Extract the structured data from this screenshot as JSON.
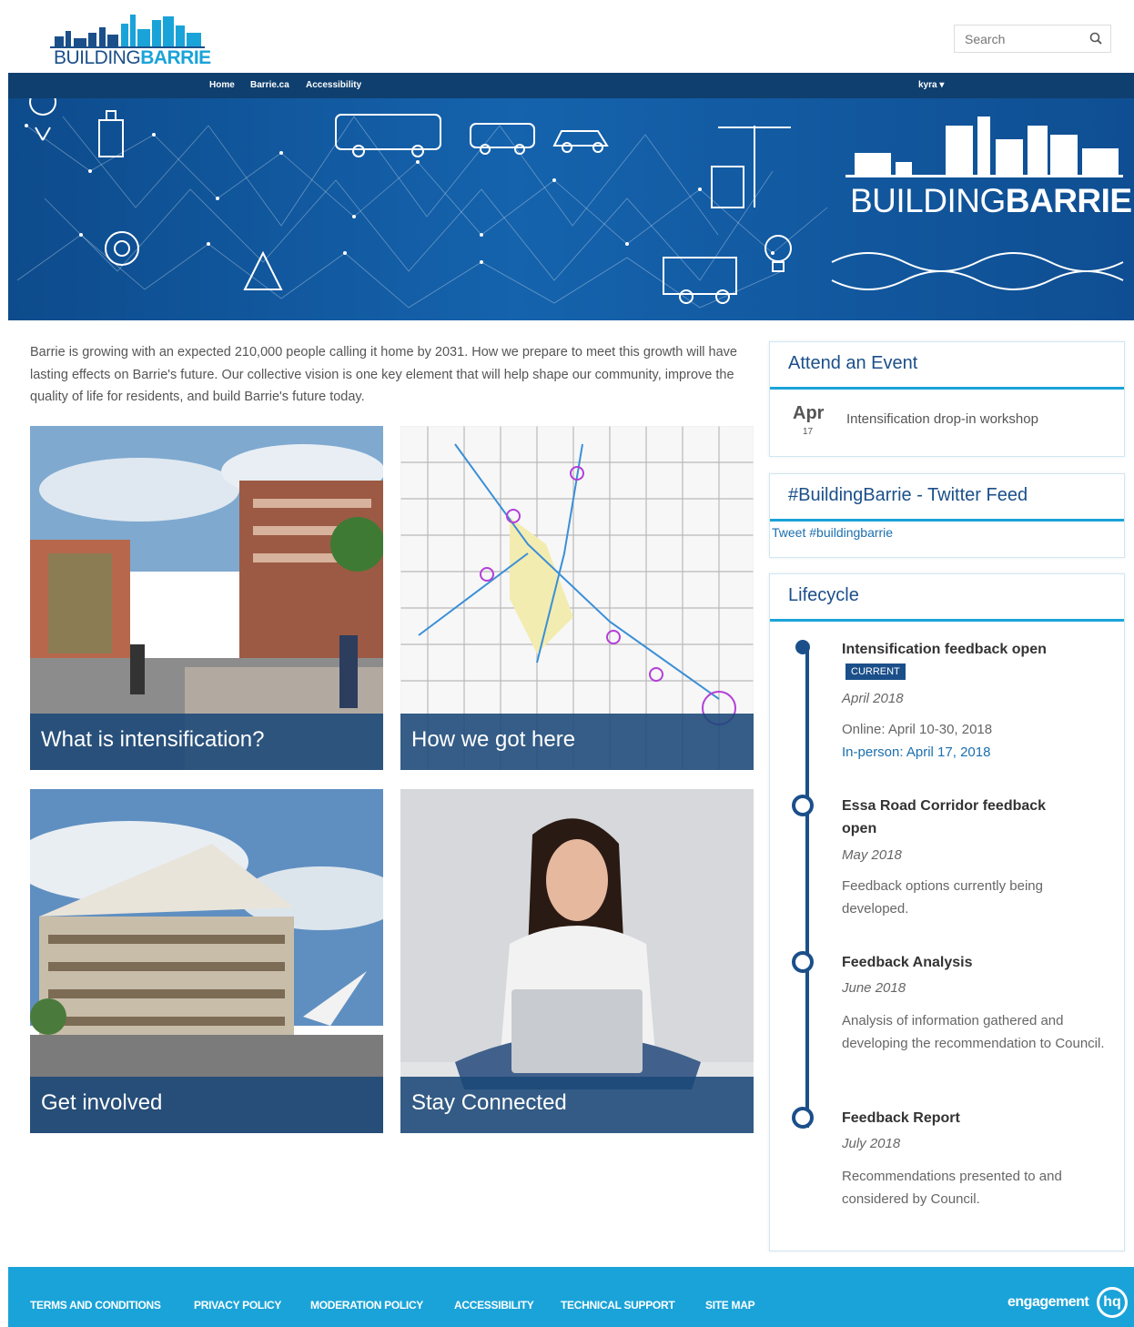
{
  "header": {
    "logo_text_a": "BUILDING",
    "logo_text_b": "BARRIE",
    "search_placeholder": "Search"
  },
  "topnav": {
    "links": [
      "Home",
      "Barrie.ca",
      "Accessibility"
    ],
    "user": "kyra ▾"
  },
  "banner": {
    "logo_text_a": "BUILDING",
    "logo_text_b": "BARRIE"
  },
  "intro": "Barrie is growing with an expected 210,000 people calling it home by 2031. How we prepare to meet this growth will have lasting effects on Barrie's future. Our collective vision is one key element that will help shape our community, improve the quality of life for residents, and build Barrie's future today.",
  "tiles": [
    {
      "label": "What is intensification?"
    },
    {
      "label": "How we got here"
    },
    {
      "label": "Get involved"
    },
    {
      "label": "Stay Connected"
    }
  ],
  "event_box": {
    "title": "Attend an Event",
    "month": "Apr",
    "day": "17",
    "event_title": "Intensification drop-in workshop"
  },
  "twitter_box": {
    "title": "#BuildingBarrie - Twitter Feed",
    "link": "Tweet #buildingbarrie"
  },
  "lifecycle": {
    "title": "Lifecycle",
    "stages": [
      {
        "title": "Intensification feedback open",
        "badge": "CURRENT",
        "date": "April 2018",
        "desc_1": "Online: April 10-30, 2018",
        "desc_2": "In-person: April 17, 2018"
      },
      {
        "title": "Essa Road Corridor feedback open",
        "date": "May 2018",
        "desc": "Feedback options currently being developed."
      },
      {
        "title": "Feedback Analysis",
        "date": "June 2018",
        "desc": "Analysis of information gathered and developing the recommendation to Council."
      },
      {
        "title": "Feedback Report",
        "date": "July 2018",
        "desc": "Recommendations presented to and considered by Council."
      }
    ]
  },
  "footer": {
    "links": [
      "TERMS AND CONDITIONS",
      "PRIVACY POLICY",
      "MODERATION POLICY",
      "ACCESSIBILITY",
      "TECHNICAL SUPPORT",
      "SITE MAP"
    ],
    "brand": "engagement",
    "brand_badge": "hq"
  },
  "colors": {
    "navy": "#0f3f6f",
    "brand_blue": "#1b4f8a",
    "accent_cyan": "#1aa3d8"
  }
}
